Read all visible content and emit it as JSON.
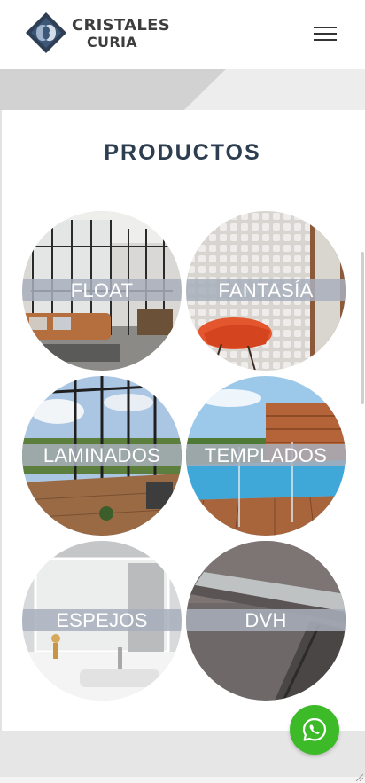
{
  "brand": {
    "name_line1": "CRISTALES",
    "name_line2": "CURIA",
    "colors": {
      "mark_dark": "#2d3e55",
      "mark_light": "#4f6f95",
      "text": "#3d3d3d"
    }
  },
  "header": {
    "menu_icon": "hamburger-menu-icon"
  },
  "section": {
    "title": "PRODUCTOS",
    "title_color": "#2c3e50"
  },
  "products": [
    {
      "label": "FLOAT",
      "image": "glass-partition-living-room"
    },
    {
      "label": "FANTASÍA",
      "image": "textured-glass-chair"
    },
    {
      "label": "LAMINADOS",
      "image": "glass-enclosed-terrace"
    },
    {
      "label": "TEMPLADOS",
      "image": "pool-glass-fence"
    },
    {
      "label": "ESPEJOS",
      "image": "bathroom-mirror"
    },
    {
      "label": "DVH",
      "image": "double-glazing-closeup"
    }
  ],
  "floating": {
    "whatsapp_icon": "whatsapp-icon",
    "whatsapp_color": "#3cba28"
  }
}
